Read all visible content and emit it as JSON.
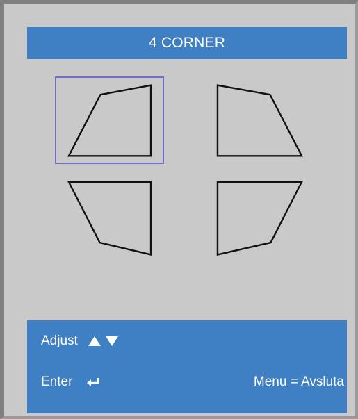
{
  "title": "4 CORNER",
  "corners": [
    {
      "id": "top-left",
      "selected": true
    },
    {
      "id": "top-right",
      "selected": false
    },
    {
      "id": "bottom-left",
      "selected": false
    },
    {
      "id": "bottom-right",
      "selected": false
    }
  ],
  "help": {
    "adjust_label": "Adjust",
    "adjust_icons": [
      "up-triangle-icon",
      "down-triangle-icon"
    ],
    "enter_label": "Enter",
    "enter_icon": "enter-return-icon",
    "menu_label": "Menu = Avsluta"
  },
  "colors": {
    "panel_background": "#c9c9c9",
    "bar_blue": "#3f7fc4",
    "selection_border": "#6f6fc8",
    "text": "#ffffff"
  }
}
